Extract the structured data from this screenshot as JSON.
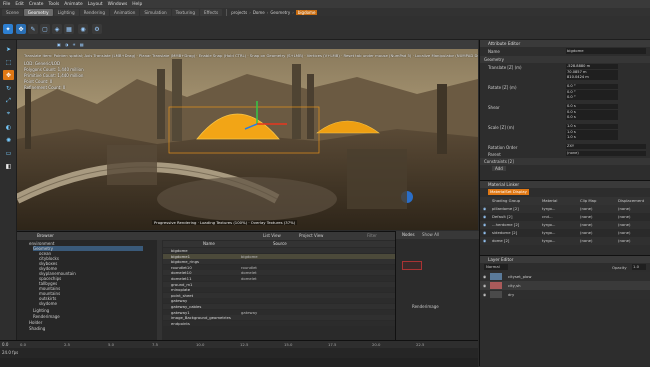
{
  "menu": [
    "File",
    "Edit",
    "Create",
    "Tools",
    "Animate",
    "Layout",
    "Windows",
    "Help"
  ],
  "tabs": [
    "Scene",
    "Geometry",
    "Lighting",
    "Rendering",
    "Animation",
    "Simulation",
    "Texturing",
    "Effects"
  ],
  "project": {
    "name": "projects",
    "sep1": "Dome",
    "sep2": "Geometry",
    "selected": "bigdome"
  },
  "viewport": {
    "hint": "Translate Item: Pointer: spatial; Axis Translate (LMB+Drag) · Planar Translate (MMB+Drag) · Enable Snap (Hold CTRL) · Snap on Geometry (S+LMB) · Vertices (V+LMB) · Reset tab under mouse (NumPad 5) · Localize Manipulator (NUMPAD Del) · Extra: Offset mode (Alt)",
    "stats": [
      "LOD: Generic/LOD",
      "Polygons Count: 1,440 million",
      "Primitive Count: 1,440 million",
      "Point Count: 0",
      "Refinement Count: 0"
    ],
    "renderStatus": "Progressive Rendering · Loading Textures (100%) · Overlay Textures (37%)"
  },
  "browser": {
    "title": "Browser",
    "tree": [
      "environment",
      "Geometry",
      "ocean",
      "cityblocks",
      "skyboxes",
      "skydome",
      "skyplanemountain",
      "spacechips",
      "tallbyges",
      "mountains",
      "mountains",
      "outskirts",
      "skydome",
      "Lighting",
      "Renderimage",
      "Holder",
      "Shading"
    ],
    "columns": [
      "Name",
      "Source"
    ],
    "rows": [
      {
        "name": "bigdome",
        "source": ""
      },
      {
        "name": "bigdome1",
        "source": "bigdome"
      },
      {
        "name": "bigdome_rings",
        "source": ""
      },
      {
        "name": "roundlet10",
        "source": "roundlet"
      },
      {
        "name": "domelet10",
        "source": "domelet"
      },
      {
        "name": "domelet11",
        "source": "domelet"
      },
      {
        "name": "ground_m1",
        "source": ""
      },
      {
        "name": "minoplate",
        "source": ""
      },
      {
        "name": "point_sheet",
        "source": ""
      },
      {
        "name": "gateway",
        "source": ""
      },
      {
        "name": "gateway_cables",
        "source": ""
      },
      {
        "name": "gateway1",
        "source": "gateway"
      },
      {
        "name": "image_Background_geometries",
        "source": ""
      },
      {
        "name": "endpoints",
        "source": ""
      }
    ],
    "listView": "List View",
    "projectView": "Project View",
    "filter": "Filter"
  },
  "rview": {
    "item": "Renderimage",
    "showAll": "Show All",
    "tab": "Nodes"
  },
  "timeline": {
    "start": "0.0",
    "end": "24.0 fps",
    "ticks": [
      "0.0",
      "2.5",
      "5.0",
      "7.5",
      "10.0",
      "12.5",
      "15.0",
      "17.5",
      "20.0",
      "22.5"
    ]
  },
  "attr": {
    "title": "Attribute Editor",
    "name": "bigdome",
    "section": "Geometry",
    "rows": [
      {
        "label": "Translate [Z] (m)",
        "vals": [
          "-528.8880 m",
          "70.0857 m",
          "810.0424 m"
        ]
      },
      {
        "label": "Rotate [Z] (m)",
        "vals": [
          "0.0 °",
          "0.0 °",
          "0.0 °"
        ]
      },
      {
        "label": "Shear",
        "vals": [
          "0.0 s",
          "0.0 s",
          "0.0 s"
        ]
      },
      {
        "label": "Scale [Z] (m)",
        "vals": [
          "1.0 s",
          "1.0 s",
          "1.0 s"
        ]
      }
    ],
    "rotationOrder": {
      "label": "Rotation Order",
      "value": "ZXY"
    },
    "parent": {
      "label": "Parent",
      "value": "(none)"
    },
    "constraints": "Constraints [2]",
    "add": "Add"
  },
  "matlinker": {
    "title": "Material Linker",
    "tab": "MaterialSet Display",
    "columns": [
      "Shading Group",
      "Material",
      "Clip Map",
      "Displacement"
    ],
    "rows": [
      {
        "group": "pillardome [2]",
        "material": "tyrgo...",
        "clip": "(none)",
        "disp": "(none)"
      },
      {
        "group": "Default [2]",
        "material": "cnd...",
        "clip": "(none)",
        "disp": "(none)"
      },
      {
        "group": "...herdome [2]",
        "material": "tyrgo...",
        "clip": "(none)",
        "disp": "(none)"
      },
      {
        "group": "sidedome [2]",
        "material": "tyrgo...",
        "clip": "(none)",
        "disp": "(none)"
      },
      {
        "group": "dome [2]",
        "material": "tyrgo...",
        "clip": "(none)",
        "disp": "(none)"
      }
    ]
  },
  "layer": {
    "title": "Layer Editor",
    "blend": "Normal",
    "opacityLabel": "Opacity",
    "opacity": "1.0",
    "layers": [
      "cityset_plow",
      "city,sh",
      "dry"
    ]
  },
  "colors": {
    "accent": "#f07a1a",
    "selected": "#e8a200",
    "link": "#3b9fe0"
  }
}
